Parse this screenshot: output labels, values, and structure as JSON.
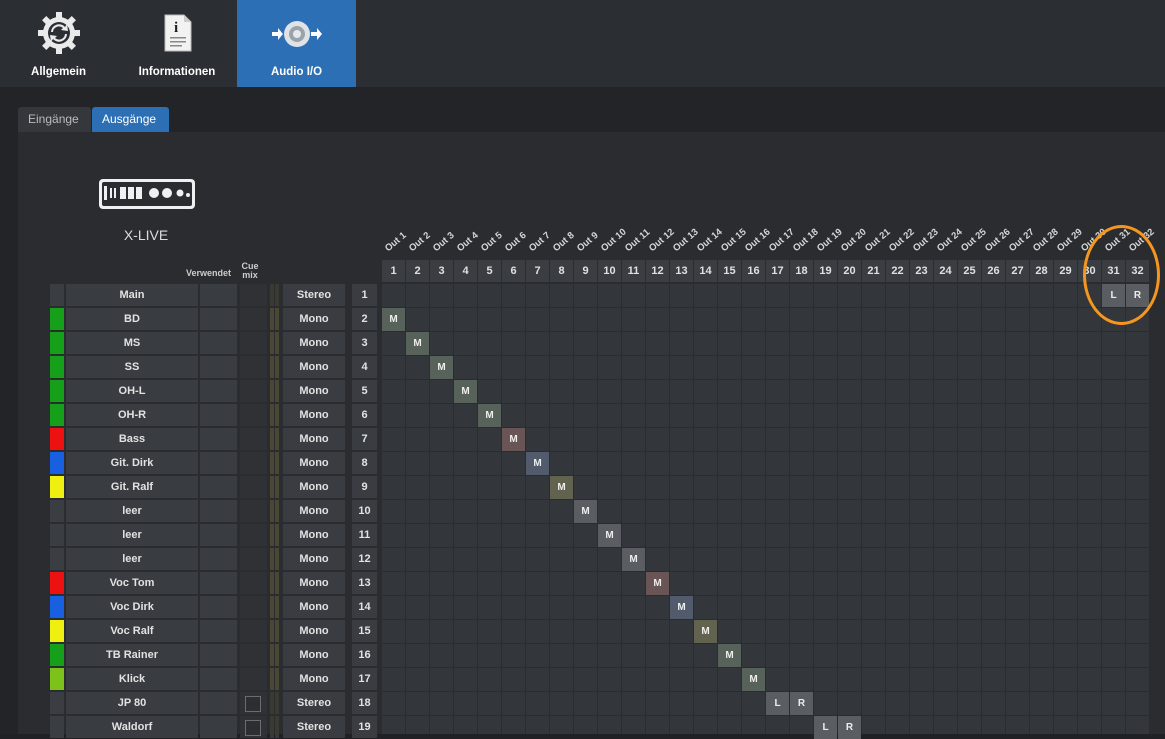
{
  "top_tabs": [
    {
      "label": "Allgemein",
      "icon": "sync-gear-icon",
      "active": false
    },
    {
      "label": "Informationen",
      "icon": "info-document-icon",
      "active": false
    },
    {
      "label": "Audio I/O",
      "icon": "audio-io-icon",
      "active": true
    }
  ],
  "sub_tabs": [
    {
      "label": "Eingänge",
      "active": false
    },
    {
      "label": "Ausgänge",
      "active": true
    }
  ],
  "device": {
    "name": "X-LIVE",
    "icon": "mixer-device-icon"
  },
  "column_headers": {
    "used": "Verwendet",
    "cue_mix": "Cue mix"
  },
  "outputs": [
    "Out 1",
    "Out 2",
    "Out 3",
    "Out 4",
    "Out 5",
    "Out 6",
    "Out 7",
    "Out 8",
    "Out 9",
    "Out 10",
    "Out 11",
    "Out 12",
    "Out 13",
    "Out 14",
    "Out 15",
    "Out 16",
    "Out 17",
    "Out 18",
    "Out 19",
    "Out 20",
    "Out 21",
    "Out 22",
    "Out 23",
    "Out 24",
    "Out 25",
    "Out 26",
    "Out 27",
    "Out 28",
    "Out 29",
    "Out 30",
    "Out 31",
    "Out 32"
  ],
  "output_numbers": [
    "1",
    "2",
    "3",
    "4",
    "5",
    "6",
    "7",
    "8",
    "9",
    "10",
    "11",
    "12",
    "13",
    "14",
    "15",
    "16",
    "17",
    "18",
    "19",
    "20",
    "21",
    "22",
    "23",
    "24",
    "25",
    "26",
    "27",
    "28",
    "29",
    "30",
    "31",
    "32"
  ],
  "channels": [
    {
      "name": "Main",
      "type": "Stereo",
      "num": "1",
      "color": "#3a3d41",
      "cue": false,
      "marks": [
        [
          "L",
          31
        ],
        [
          "R",
          32
        ]
      ],
      "mark_color": "#5a5d61"
    },
    {
      "name": "BD",
      "type": "Mono",
      "num": "2",
      "color": "#16a01a",
      "cue": true,
      "marks": [
        [
          "M",
          1
        ]
      ],
      "mark_color": "#56625a"
    },
    {
      "name": "MS",
      "type": "Mono",
      "num": "3",
      "color": "#16a01a",
      "cue": true,
      "marks": [
        [
          "M",
          2
        ]
      ],
      "mark_color": "#56625a"
    },
    {
      "name": "SS",
      "type": "Mono",
      "num": "4",
      "color": "#16a01a",
      "cue": true,
      "marks": [
        [
          "M",
          3
        ]
      ],
      "mark_color": "#56625a"
    },
    {
      "name": "OH-L",
      "type": "Mono",
      "num": "5",
      "color": "#16a01a",
      "cue": true,
      "marks": [
        [
          "M",
          4
        ]
      ],
      "mark_color": "#56625a"
    },
    {
      "name": "OH-R",
      "type": "Mono",
      "num": "6",
      "color": "#16a01a",
      "cue": true,
      "marks": [
        [
          "M",
          5
        ]
      ],
      "mark_color": "#56625a"
    },
    {
      "name": "Bass",
      "type": "Mono",
      "num": "7",
      "color": "#ee1111",
      "cue": true,
      "marks": [
        [
          "M",
          6
        ]
      ],
      "mark_color": "#6a5556"
    },
    {
      "name": "Git. Dirk",
      "type": "Mono",
      "num": "8",
      "color": "#1860e0",
      "cue": true,
      "marks": [
        [
          "M",
          7
        ]
      ],
      "mark_color": "#525b6c"
    },
    {
      "name": "Git. Ralf",
      "type": "Mono",
      "num": "9",
      "color": "#eef010",
      "cue": true,
      "marks": [
        [
          "M",
          8
        ]
      ],
      "mark_color": "#62634e"
    },
    {
      "name": "leer",
      "type": "Mono",
      "num": "10",
      "color": "#3a3d41",
      "cue": true,
      "marks": [
        [
          "M",
          9
        ]
      ],
      "mark_color": "#5a5d61"
    },
    {
      "name": "leer",
      "type": "Mono",
      "num": "11",
      "color": "#3a3d41",
      "cue": true,
      "marks": [
        [
          "M",
          10
        ]
      ],
      "mark_color": "#5a5d61"
    },
    {
      "name": "leer",
      "type": "Mono",
      "num": "12",
      "color": "#3a3d41",
      "cue": true,
      "marks": [
        [
          "M",
          11
        ]
      ],
      "mark_color": "#5a5d61"
    },
    {
      "name": "Voc Tom",
      "type": "Mono",
      "num": "13",
      "color": "#ee1111",
      "cue": true,
      "marks": [
        [
          "M",
          12
        ]
      ],
      "mark_color": "#6a5556"
    },
    {
      "name": "Voc Dirk",
      "type": "Mono",
      "num": "14",
      "color": "#1860e0",
      "cue": true,
      "marks": [
        [
          "M",
          13
        ]
      ],
      "mark_color": "#525b6c"
    },
    {
      "name": "Voc Ralf",
      "type": "Mono",
      "num": "15",
      "color": "#eef010",
      "cue": true,
      "marks": [
        [
          "M",
          14
        ]
      ],
      "mark_color": "#62634e"
    },
    {
      "name": "TB Rainer",
      "type": "Mono",
      "num": "16",
      "color": "#16a01a",
      "cue": true,
      "marks": [
        [
          "M",
          15
        ]
      ],
      "mark_color": "#56625a"
    },
    {
      "name": "Klick",
      "type": "Mono",
      "num": "17",
      "color": "#7cc21a",
      "cue": true,
      "marks": [
        [
          "M",
          16
        ]
      ],
      "mark_color": "#56625a"
    },
    {
      "name": "JP 80",
      "type": "Stereo",
      "num": "18",
      "color": "#3a3d41",
      "cue": false,
      "checkbox": true,
      "marks": [
        [
          "L",
          17
        ],
        [
          "R",
          18
        ]
      ],
      "mark_color": "#5a5d61"
    },
    {
      "name": "Waldorf",
      "type": "Stereo",
      "num": "19",
      "color": "#3a3d41",
      "cue": false,
      "checkbox": true,
      "marks": [
        [
          "L",
          19
        ],
        [
          "R",
          20
        ]
      ],
      "mark_color": "#5a5d61"
    }
  ],
  "colors": {
    "accent": "#2c6fb4",
    "highlight_circle": "#f5961e"
  }
}
